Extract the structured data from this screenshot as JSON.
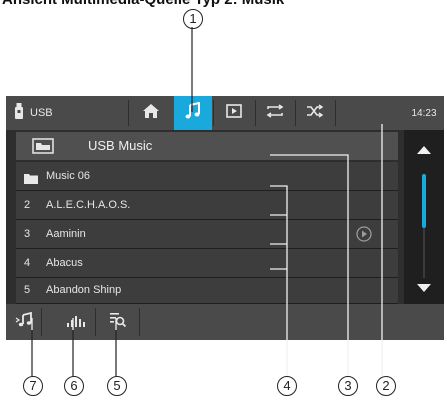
{
  "caption": "Ansicht Multimedia-Quelle Typ 2: Musik",
  "callouts": [
    "1",
    "2",
    "3",
    "4",
    "5",
    "6",
    "7"
  ],
  "topbar": {
    "source_label": "USB",
    "clock": "14:23",
    "icons": [
      "usb-drive-icon",
      "home-icon",
      "music-note-icon",
      "video-icon",
      "repeat-icon",
      "shuffle-icon"
    ],
    "active_color": "#1aa9dd"
  },
  "header": {
    "title": "USB Music"
  },
  "list": [
    {
      "num": "",
      "title": "Music 06",
      "type": "folder"
    },
    {
      "num": "2",
      "title": "A.L.E.C.H.A.O.S.",
      "type": "track"
    },
    {
      "num": "3",
      "title": "Aaminin",
      "type": "track"
    },
    {
      "num": "4",
      "title": "Abacus",
      "type": "track"
    },
    {
      "num": "5",
      "title": "Abandon Shinp",
      "type": "track"
    }
  ],
  "scrollbar": {
    "accent": "#1aa9dd"
  },
  "bottombar": {
    "icons": [
      "now-playing-icon",
      "equalizer-icon",
      "search-list-icon"
    ]
  }
}
